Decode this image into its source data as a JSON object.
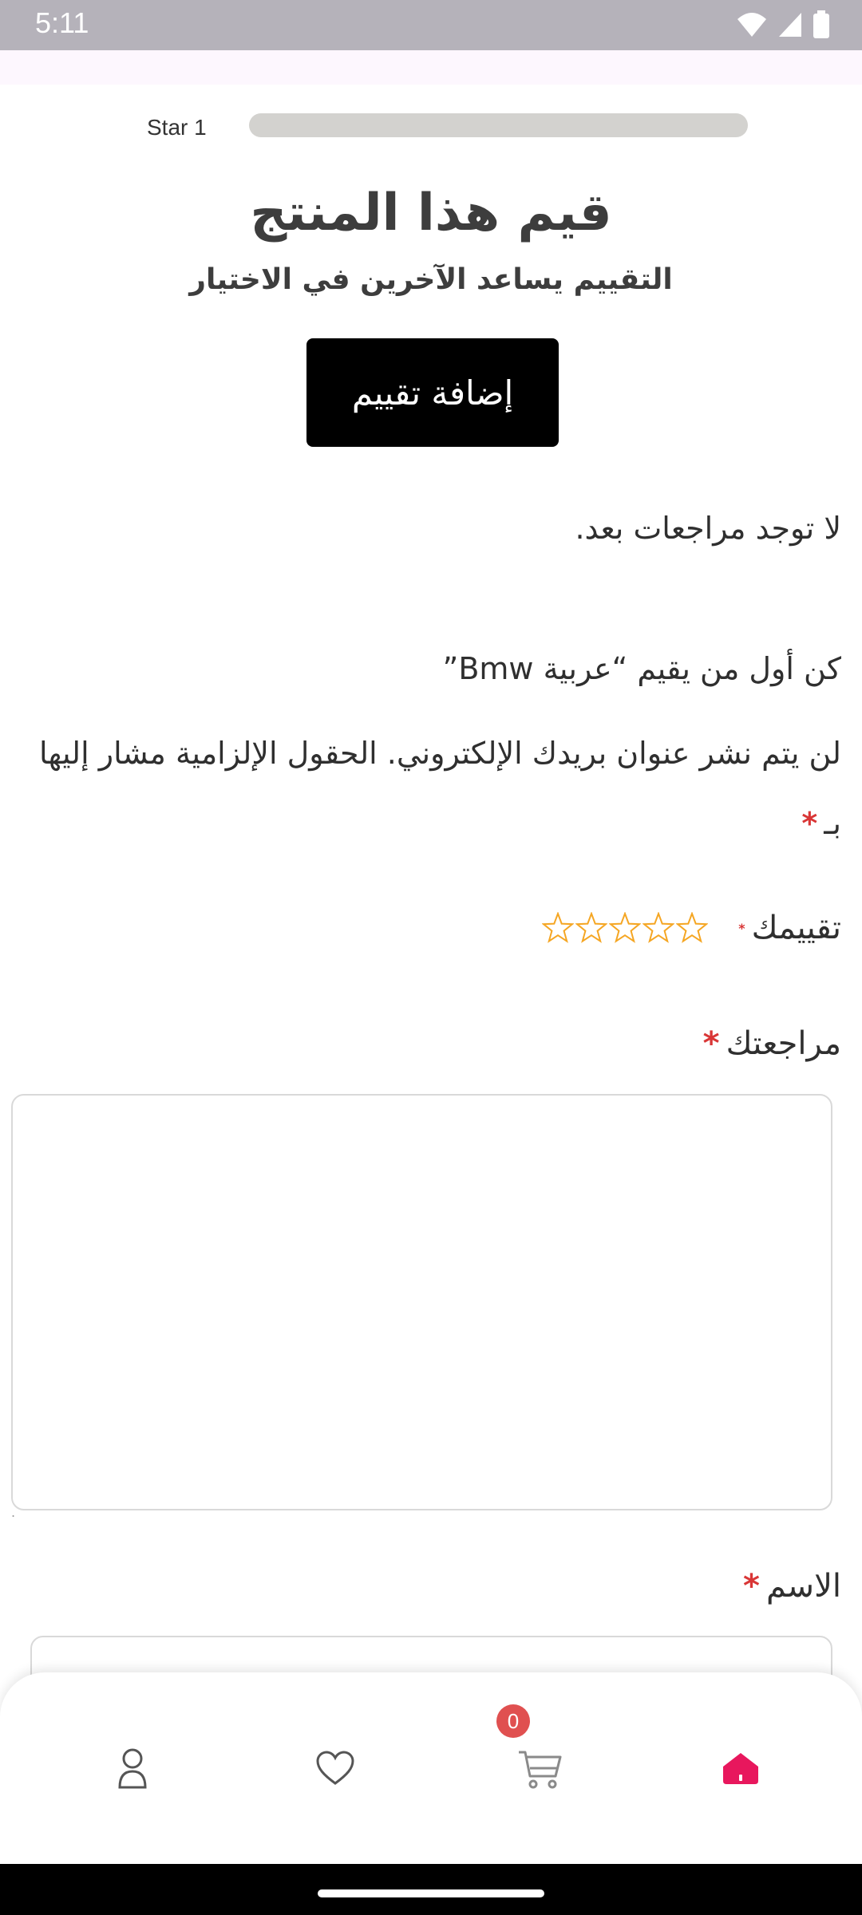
{
  "status_bar": {
    "time": "5:11"
  },
  "rating_bars": [
    {
      "label": "Star 1",
      "fill_fraction": 0
    }
  ],
  "header": {
    "title": "قيم هذا المنتج",
    "subtitle": "التقييم يساعد الآخرين في الاختيار"
  },
  "add_review_label": "إضافة تقييم",
  "reviews": {
    "empty_message": "لا توجد مراجعات بعد."
  },
  "form": {
    "be_first": "كن أول من يقيم “عربية Bmw”",
    "email_note": "لن يتم نشر عنوان بريدك الإلكتروني. الحقول الإلزامية مشار إليها بـ",
    "required_mark": "*",
    "rating_label": "تقييمك",
    "rating_value": 0,
    "rating_max": 5,
    "review_label": "مراجعتك",
    "review_value": "",
    "name_label": "الاسم",
    "name_value": ""
  },
  "bottom_nav": {
    "items": [
      "account-icon",
      "wishlist-icon",
      "cart-icon",
      "home-icon"
    ],
    "cart_count": "0",
    "active": "home"
  },
  "colors": {
    "accent": "#e8175d",
    "star": "#f5a623",
    "required": "#d93636",
    "button_bg": "#000000",
    "badge": "#e05050"
  }
}
